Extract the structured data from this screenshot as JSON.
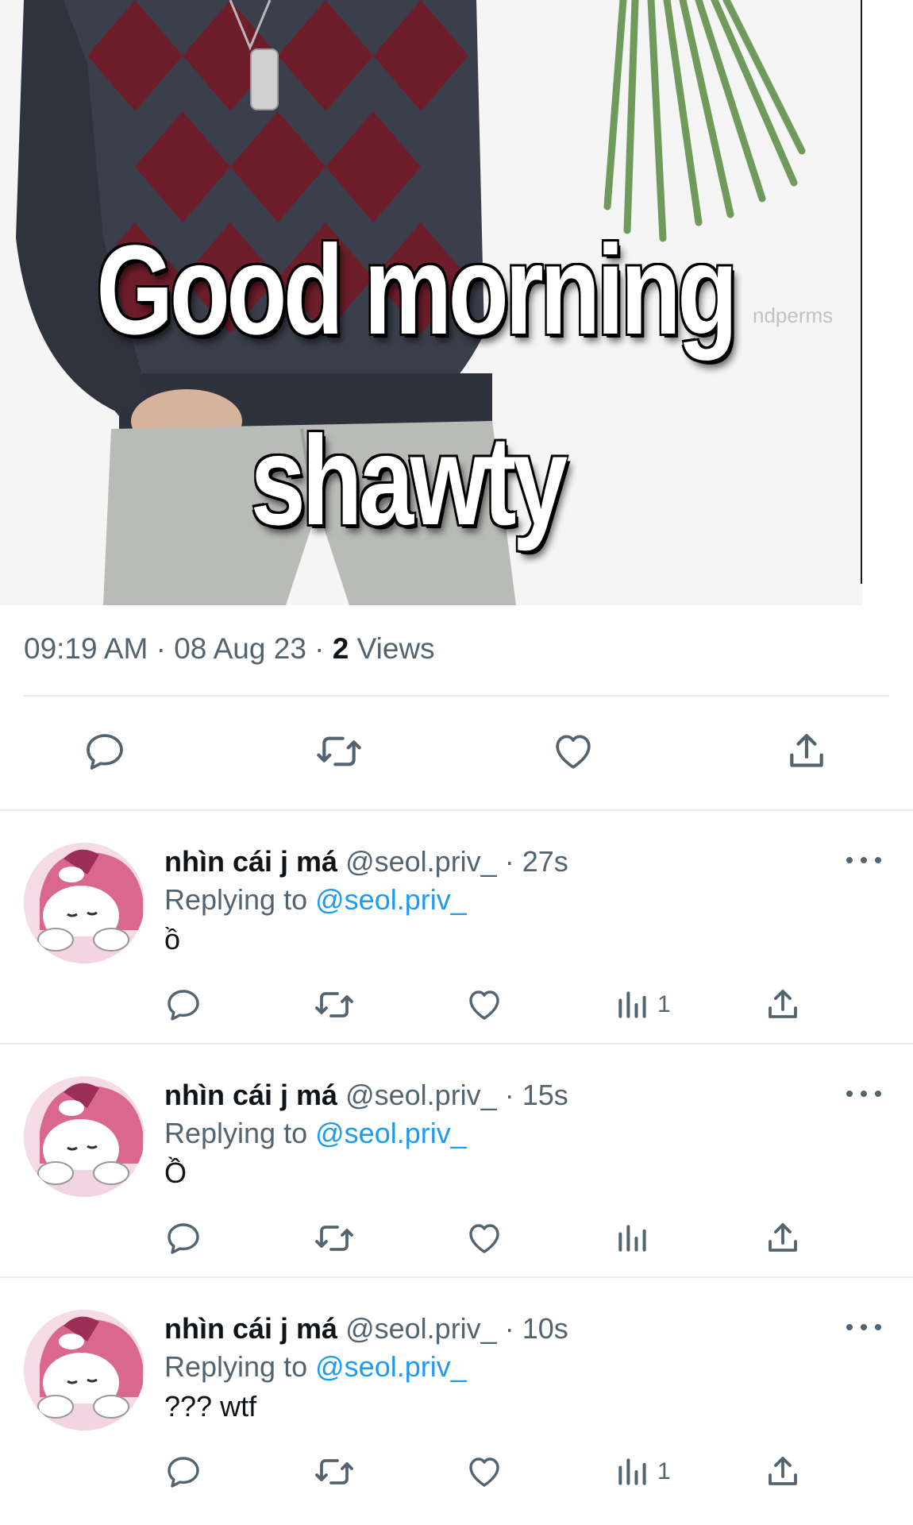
{
  "media": {
    "caption_line1": "Good morning",
    "caption_line2": "shawty",
    "watermark": "ndperms"
  },
  "tweet_meta": {
    "time": "09:19 AM",
    "date": "08 Aug 23",
    "views_count": "2",
    "views_label": "Views"
  },
  "replies": [
    {
      "name": "nhìn cái j má",
      "handle": "@seol.priv_",
      "age": "27s",
      "replying_prefix": "Replying to",
      "replying_handle": "@seol.priv_",
      "text": "ồ",
      "views": "1"
    },
    {
      "name": "nhìn cái j má",
      "handle": "@seol.priv_",
      "age": "15s",
      "replying_prefix": "Replying to",
      "replying_handle": "@seol.priv_",
      "text": "Ồ",
      "views": ""
    },
    {
      "name": "nhìn cái j má",
      "handle": "@seol.priv_",
      "age": "10s",
      "replying_prefix": "Replying to",
      "replying_handle": "@seol.priv_",
      "text": "??? wtf",
      "views": "1"
    }
  ],
  "icons": {
    "reply": "reply-icon",
    "retweet": "retweet-icon",
    "like": "heart-icon",
    "views": "analytics-icon",
    "share": "share-icon",
    "more": "more-icon"
  },
  "colors": {
    "link": "#1d9bf0",
    "secondary_text": "#536471",
    "primary_text": "#0f1419",
    "divider": "#e6ecf0"
  }
}
